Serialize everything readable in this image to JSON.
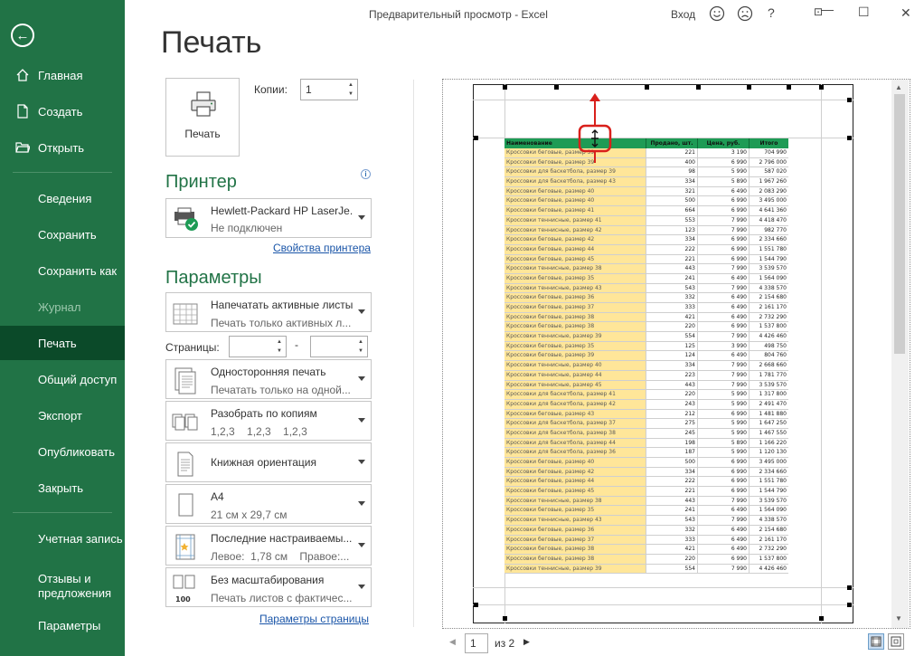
{
  "window": {
    "title": "Предварительный просмотр  -  Excel",
    "login": "Вход",
    "min": "—",
    "max": "☐",
    "close": "✕",
    "help": "?",
    "ribbon_options": "⊡"
  },
  "sidebar": {
    "back": "←",
    "items": [
      {
        "label": "Главная",
        "icon": "home-icon"
      },
      {
        "label": "Создать",
        "icon": "new-document-icon"
      },
      {
        "label": "Открыть",
        "icon": "open-folder-icon"
      },
      {
        "label": "Сведения"
      },
      {
        "label": "Сохранить"
      },
      {
        "label": "Сохранить как"
      },
      {
        "label": "Журнал"
      },
      {
        "label": "Печать"
      },
      {
        "label": "Общий доступ"
      },
      {
        "label": "Экспорт"
      },
      {
        "label": "Опубликовать"
      },
      {
        "label": "Закрыть"
      },
      {
        "label": "Учетная запись"
      },
      {
        "label": "Отзывы и предложения"
      },
      {
        "label": "Параметры"
      }
    ],
    "accent": "#217346"
  },
  "print": {
    "page_title": "Печать",
    "button_label": "Печать",
    "copies_label": "Копии:",
    "copies_value": "1"
  },
  "printer": {
    "section": "Принтер",
    "name": "Hewlett-Packard HP LaserJe...",
    "status": "Не подключен",
    "properties_link": "Свойства принтера"
  },
  "settings": {
    "section": "Параметры",
    "what": {
      "title": "Напечатать активные листы",
      "subtitle": "Печать только активных л..."
    },
    "pages_label": "Страницы:",
    "pages_from": "",
    "pages_to": "",
    "pages_dash": "-",
    "sides": {
      "title": "Односторонняя печать",
      "subtitle": "Печатать только на одной..."
    },
    "collate": {
      "title": "Разобрать по копиям",
      "subtitle": "1,2,3    1,2,3    1,2,3"
    },
    "orientation": {
      "title": "Книжная ориентация"
    },
    "paper": {
      "title": "A4",
      "subtitle": "21 см x 29,7 см"
    },
    "margins": {
      "title": "Последние настраиваемы...",
      "subtitle": "Левое:  1,78 см    Правое:..."
    },
    "scaling": {
      "title": "Без масштабирования",
      "subtitle": "Печать листов с фактичес..."
    },
    "page_setup_link": "Параметры страницы"
  },
  "preview": {
    "headers": [
      "Наименование",
      "Продано, шт.",
      "Цена, руб.",
      "Итого"
    ],
    "rows": [
      [
        "Кроссовки беговые, размер 39",
        "221",
        "3 190",
        "704 990"
      ],
      [
        "Кроссовки беговые, размер 39",
        "400",
        "6 990",
        "2 796 000"
      ],
      [
        "Кроссовки для баскетбола, размер 39",
        "98",
        "5 990",
        "587 020"
      ],
      [
        "Кроссовки для баскетбола, размер 43",
        "334",
        "5 890",
        "1 967 260"
      ],
      [
        "Кроссовки беговые, размер 40",
        "321",
        "6 490",
        "2 083 290"
      ],
      [
        "Кроссовки беговые, размер 40",
        "500",
        "6 990",
        "3 495 000"
      ],
      [
        "Кроссовки беговые, размер 41",
        "664",
        "6 990",
        "4 641 360"
      ],
      [
        "Кроссовки теннисные, размер 41",
        "553",
        "7 990",
        "4 418 470"
      ],
      [
        "Кроссовки теннисные, размер 42",
        "123",
        "7 990",
        "982 770"
      ],
      [
        "Кроссовки беговые, размер 42",
        "334",
        "6 990",
        "2 334 660"
      ],
      [
        "Кроссовки беговые, размер 44",
        "222",
        "6 990",
        "1 551 780"
      ],
      [
        "Кроссовки беговые, размер 45",
        "221",
        "6 990",
        "1 544 790"
      ],
      [
        "Кроссовки теннисные, размер 38",
        "443",
        "7 990",
        "3 539 570"
      ],
      [
        "Кроссовки беговые, размер 35",
        "241",
        "6 490",
        "1 564 090"
      ],
      [
        "Кроссовки теннисные, размер 43",
        "543",
        "7 990",
        "4 338 570"
      ],
      [
        "Кроссовки беговые, размер 36",
        "332",
        "6 490",
        "2 154 680"
      ],
      [
        "Кроссовки беговые, размер 37",
        "333",
        "6 490",
        "2 161 170"
      ],
      [
        "Кроссовки беговые, размер 38",
        "421",
        "6 490",
        "2 732 290"
      ],
      [
        "Кроссовки беговые, размер 38",
        "220",
        "6 990",
        "1 537 800"
      ],
      [
        "Кроссовки теннисные, размер 39",
        "554",
        "7 990",
        "4 426 460"
      ],
      [
        "Кроссовки беговые, размер 35",
        "125",
        "3 990",
        "498 750"
      ],
      [
        "Кроссовки беговые, размер 39",
        "124",
        "6 490",
        "804 760"
      ],
      [
        "Кроссовки теннисные, размер 40",
        "334",
        "7 990",
        "2 668 660"
      ],
      [
        "Кроссовки теннисные, размер 44",
        "223",
        "7 990",
        "1 781 770"
      ],
      [
        "Кроссовки теннисные, размер 45",
        "443",
        "7 990",
        "3 539 570"
      ],
      [
        "Кроссовки для баскетбола, размер 41",
        "220",
        "5 990",
        "1 317 800"
      ],
      [
        "Кроссовки для баскетбола, размер 42",
        "243",
        "5 990",
        "2 491 470"
      ],
      [
        "Кроссовки беговые, размер 43",
        "212",
        "6 990",
        "1 481 880"
      ],
      [
        "Кроссовки для баскетбола, размер 37",
        "275",
        "5 990",
        "1 647 250"
      ],
      [
        "Кроссовки для баскетбола, размер 38",
        "245",
        "5 990",
        "1 467 550"
      ],
      [
        "Кроссовки для баскетбола, размер 44",
        "198",
        "5 890",
        "1 166 220"
      ],
      [
        "Кроссовки для баскетбола, размер 36",
        "187",
        "5 990",
        "1 120 130"
      ],
      [
        "Кроссовки беговые, размер 40",
        "500",
        "6 990",
        "3 495 000"
      ],
      [
        "Кроссовки беговые, размер 42",
        "334",
        "6 990",
        "2 334 660"
      ],
      [
        "Кроссовки беговые, размер 44",
        "222",
        "6 990",
        "1 551 780"
      ],
      [
        "Кроссовки беговые, размер 45",
        "221",
        "6 990",
        "1 544 790"
      ],
      [
        "Кроссовки теннисные, размер 38",
        "443",
        "7 990",
        "3 539 570"
      ],
      [
        "Кроссовки беговые, размер 35",
        "241",
        "6 490",
        "1 564 090"
      ],
      [
        "Кроссовки теннисные, размер 43",
        "543",
        "7 990",
        "4 338 570"
      ],
      [
        "Кроссовки беговые, размер 36",
        "332",
        "6 490",
        "2 154 680"
      ],
      [
        "Кроссовки беговые, размер 37",
        "333",
        "6 490",
        "2 161 170"
      ],
      [
        "Кроссовки беговые, размер 38",
        "421",
        "6 490",
        "2 732 290"
      ],
      [
        "Кроссовки беговые, размер 38",
        "220",
        "6 990",
        "1 537 800"
      ],
      [
        "Кроссовки теннисные, размер 39",
        "554",
        "7 990",
        "4 426 460"
      ]
    ],
    "page_current": "1",
    "page_of": "из 2",
    "prev": "◀",
    "next": "▶"
  }
}
